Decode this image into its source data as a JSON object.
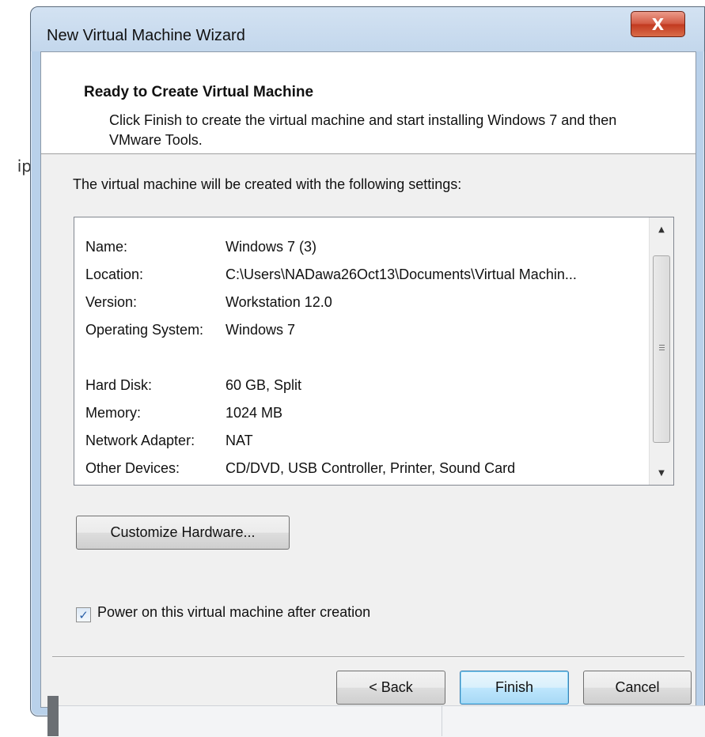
{
  "background": {
    "fragment_text": "ip"
  },
  "window": {
    "title": "New Virtual Machine Wizard",
    "close_glyph": "X"
  },
  "header": {
    "title": "Ready to Create Virtual Machine",
    "description": "Click Finish to create the virtual machine and start installing Windows 7 and then VMware Tools."
  },
  "intro": "The virtual machine will be created with the following settings:",
  "settings": [
    {
      "label": "Name:",
      "value": "Windows 7 (3)"
    },
    {
      "label": "Location:",
      "value": "C:\\Users\\NADawa26Oct13\\Documents\\Virtual Machin..."
    },
    {
      "label": "Version:",
      "value": "Workstation 12.0"
    },
    {
      "label": "Operating System:",
      "value": "Windows 7"
    },
    {
      "label": "Hard Disk:",
      "value": "60 GB, Split"
    },
    {
      "label": "Memory:",
      "value": "1024 MB"
    },
    {
      "label": "Network Adapter:",
      "value": "NAT"
    },
    {
      "label": "Other Devices:",
      "value": "CD/DVD, USB Controller, Printer, Sound Card"
    }
  ],
  "customize_button": "Customize Hardware...",
  "power_on": {
    "label": "Power on this virtual machine after creation",
    "checked": true
  },
  "footer": {
    "back_label": "< Back",
    "finish_label": "Finish",
    "cancel_label": "Cancel"
  },
  "colors": {
    "title_bar": "#c9dcef",
    "close_button": "#c9472c",
    "default_button_border": "#3c7fb1"
  }
}
